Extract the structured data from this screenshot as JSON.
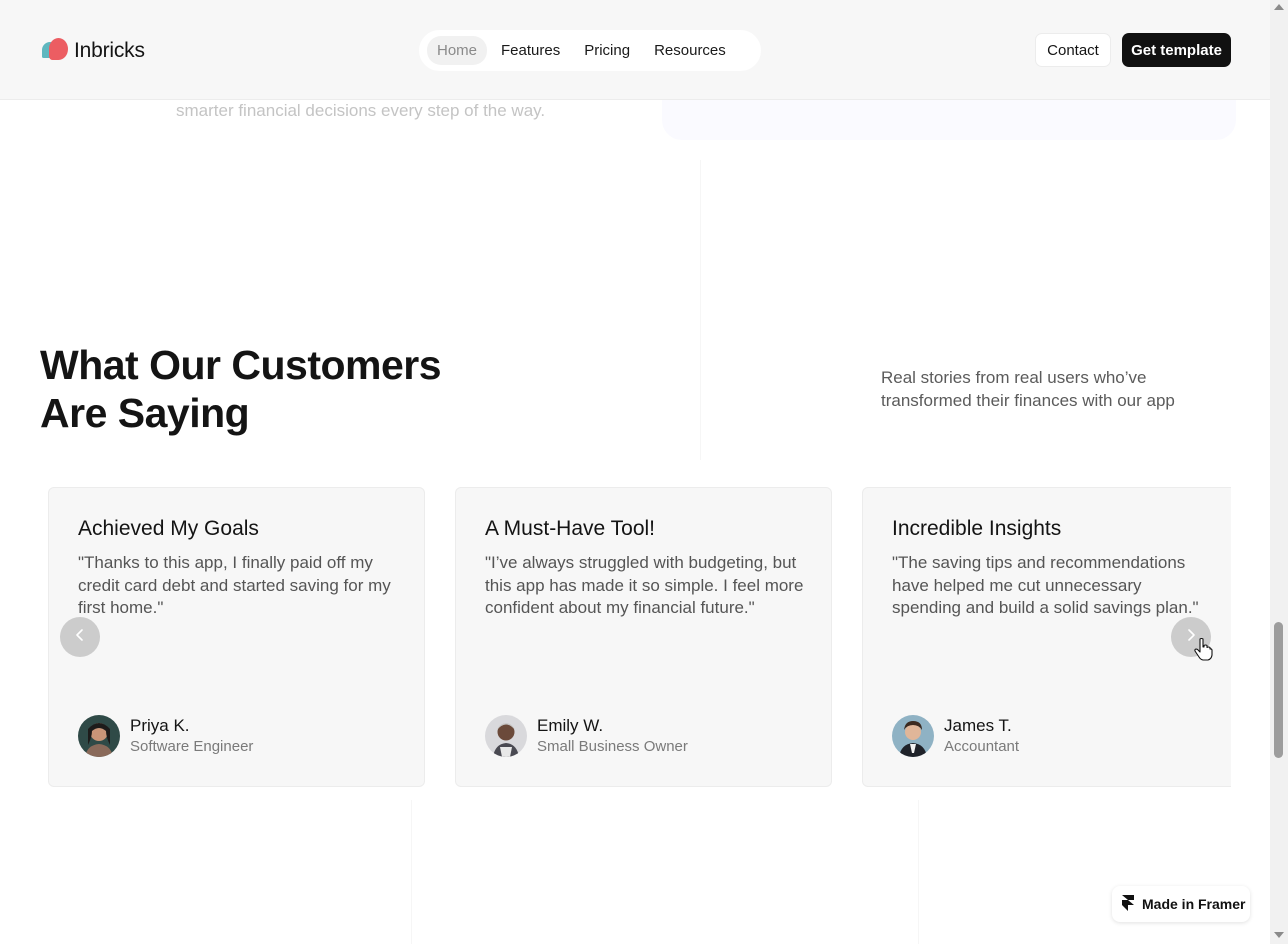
{
  "header": {
    "brand": "Inbricks",
    "nav": [
      {
        "label": "Home",
        "active": true
      },
      {
        "label": "Features",
        "active": false
      },
      {
        "label": "Pricing",
        "active": false
      },
      {
        "label": "Resources",
        "active": false
      }
    ],
    "contact_label": "Contact",
    "cta_label": "Get template"
  },
  "previous_section": {
    "faded_text": "smarter financial decisions every step of the way."
  },
  "testimonials": {
    "title_line1": "What Our Customers",
    "title_line2": "Are Saying",
    "subtitle": "Real stories from real users who’ve transformed their finances with our app",
    "cards": [
      {
        "title": "Achieved My Goals",
        "quote": "\"Thanks to this app, I finally paid off my credit card debt and started saving for my first home.\"",
        "name": "Priya K.",
        "role": "Software Engineer"
      },
      {
        "title": "A Must-Have Tool!",
        "quote": "\"I’ve always struggled with budgeting, but this app has made it so simple. I feel more confident about my financial future.\"",
        "name": "Emily W.",
        "role": "Small Business Owner"
      },
      {
        "title": "Incredible Insights",
        "quote": "\"The saving tips and recommendations have helped me cut unnecessary spending and build a solid savings plan.\"",
        "name": "James T.",
        "role": "Accountant"
      }
    ]
  },
  "badge": {
    "label": "Made in Framer"
  },
  "colors": {
    "brand_teal": "#5fb7bf",
    "brand_coral": "#ec5d62",
    "cta_background": "#111111"
  },
  "icons": {
    "prev": "chevron-left-icon",
    "next": "chevron-right-icon",
    "framer": "framer-logo-icon"
  }
}
